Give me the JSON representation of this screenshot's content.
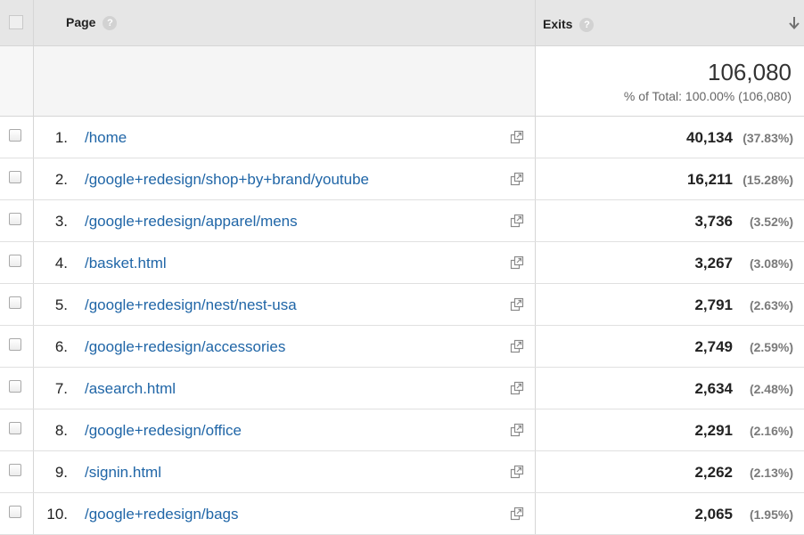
{
  "header": {
    "page_label": "Page",
    "exits_label": "Exits",
    "help_glyph": "?"
  },
  "totals": {
    "exits": "106,080",
    "percent_text": "% of Total: 100.00% (106,080)"
  },
  "rows": [
    {
      "index": "1.",
      "page": "/home",
      "exits": "40,134",
      "share": "(37.83%)"
    },
    {
      "index": "2.",
      "page": "/google+redesign/shop+by+brand/youtube",
      "exits": "16,211",
      "share": "(15.28%)"
    },
    {
      "index": "3.",
      "page": "/google+redesign/apparel/mens",
      "exits": "3,736",
      "share": "(3.52%)"
    },
    {
      "index": "4.",
      "page": "/basket.html",
      "exits": "3,267",
      "share": "(3.08%)"
    },
    {
      "index": "5.",
      "page": "/google+redesign/nest/nest-usa",
      "exits": "2,791",
      "share": "(2.63%)"
    },
    {
      "index": "6.",
      "page": "/google+redesign/accessories",
      "exits": "2,749",
      "share": "(2.59%)"
    },
    {
      "index": "7.",
      "page": "/asearch.html",
      "exits": "2,634",
      "share": "(2.48%)"
    },
    {
      "index": "8.",
      "page": "/google+redesign/office",
      "exits": "2,291",
      "share": "(2.16%)"
    },
    {
      "index": "9.",
      "page": "/signin.html",
      "exits": "2,262",
      "share": "(2.13%)"
    },
    {
      "index": "10.",
      "page": "/google+redesign/bags",
      "exits": "2,065",
      "share": "(1.95%)"
    }
  ],
  "colors": {
    "link": "#2066a7",
    "header_bg": "#e6e6e6"
  },
  "icons": {
    "open_page": "external-link-icon",
    "sort": "arrow-down-icon",
    "help": "help-icon"
  }
}
